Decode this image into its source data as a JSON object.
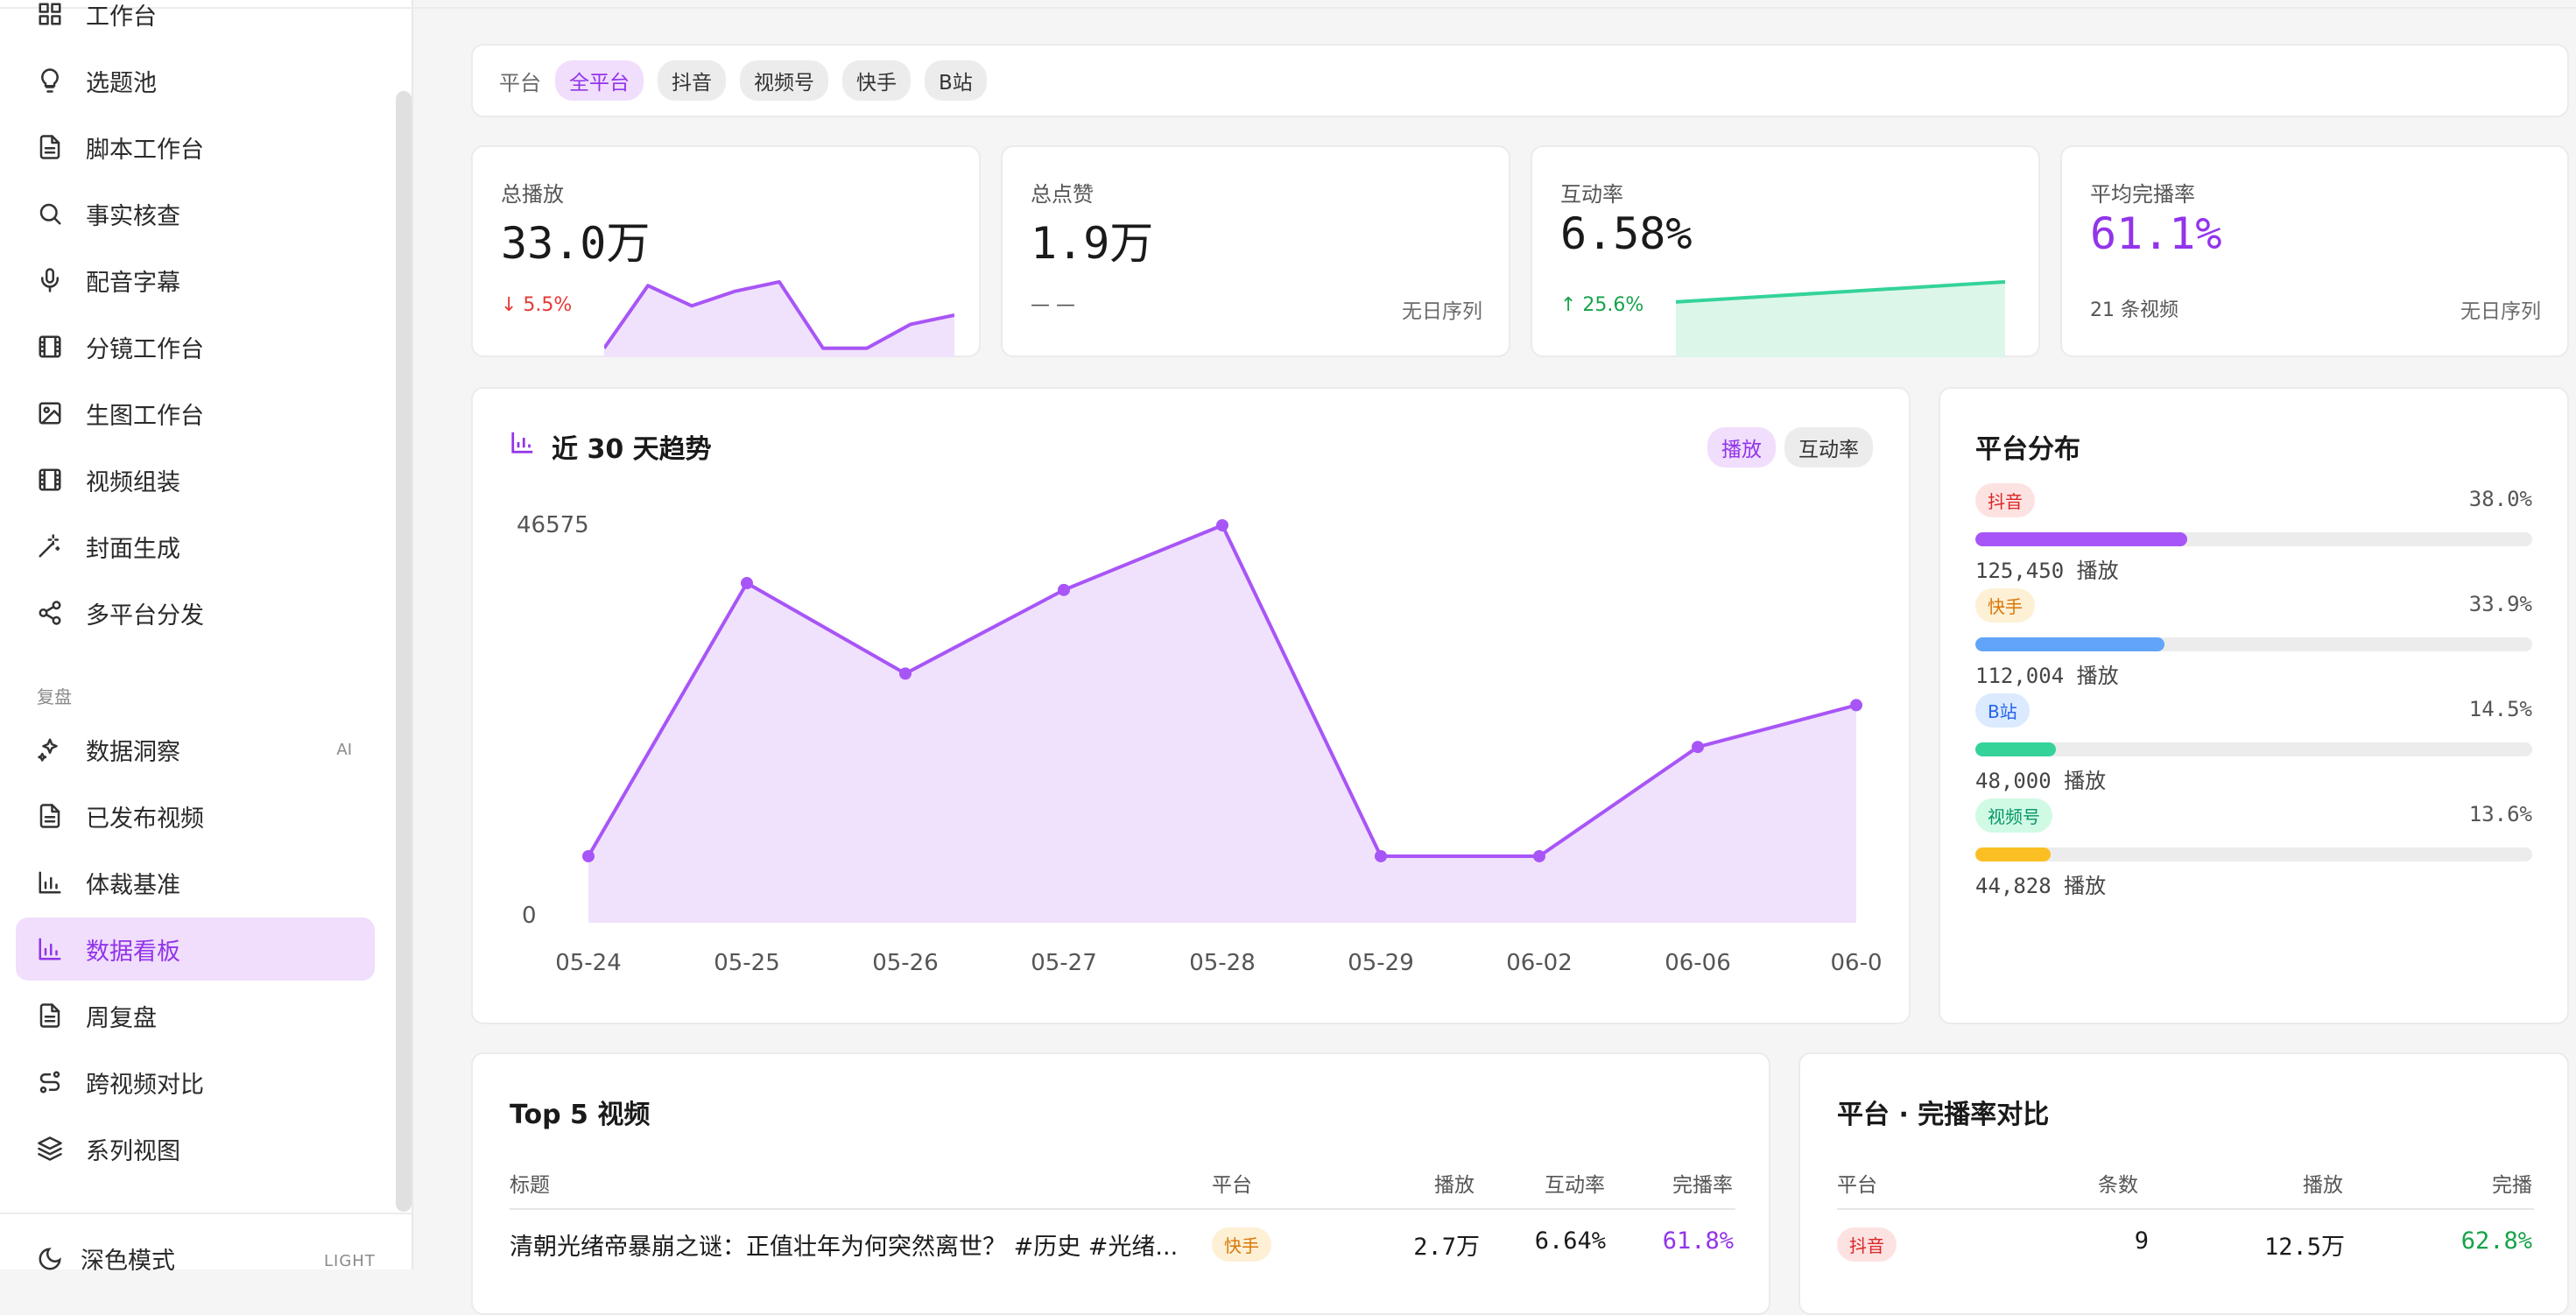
{
  "sidebar": {
    "items": [
      {
        "label": "工作台",
        "icon": "grid-icon"
      },
      {
        "label": "选题池",
        "icon": "lightbulb-icon"
      },
      {
        "label": "脚本工作台",
        "icon": "document-icon"
      },
      {
        "label": "事实核查",
        "icon": "search-icon"
      },
      {
        "label": "配音字幕",
        "icon": "microphone-icon"
      },
      {
        "label": "分镜工作台",
        "icon": "film-icon"
      },
      {
        "label": "生图工作台",
        "icon": "image-icon"
      },
      {
        "label": "视频组装",
        "icon": "film-icon"
      },
      {
        "label": "封面生成",
        "icon": "magic-wand-icon"
      },
      {
        "label": "多平台分发",
        "icon": "share-icon"
      }
    ],
    "section_review": "复盘",
    "review_items": [
      {
        "label": "数据洞察",
        "icon": "sparkles-icon",
        "badge": "AI"
      },
      {
        "label": "已发布视频",
        "icon": "document-icon"
      },
      {
        "label": "体裁基准",
        "icon": "bar-chart-icon"
      },
      {
        "label": "数据看板",
        "icon": "bar-chart-icon",
        "active": true
      },
      {
        "label": "周复盘",
        "icon": "document-icon"
      },
      {
        "label": "跨视频对比",
        "icon": "route-icon"
      },
      {
        "label": "系列视图",
        "icon": "layers-icon"
      }
    ],
    "dark_mode_label": "深色模式",
    "dark_mode_state": "LIGHT"
  },
  "filter": {
    "label": "平台",
    "chips": [
      "全平台",
      "抖音",
      "视频号",
      "快手",
      "B站"
    ],
    "active": "全平台"
  },
  "kpis": {
    "plays": {
      "label": "总播放",
      "value": "33.0万",
      "delta": "↓ 5.5%"
    },
    "likes": {
      "label": "总点赞",
      "value": "1.9万",
      "delta": "— —",
      "note": "无日序列"
    },
    "engagement": {
      "label": "互动率",
      "value": "6.58%",
      "delta": "↑ 25.6%"
    },
    "completion": {
      "label": "平均完播率",
      "value": "61.1%",
      "count": "21 条视频",
      "note": "无日序列"
    }
  },
  "trend": {
    "title": "近 30 天趋势",
    "toggle_plays": "播放",
    "toggle_engagement": "互动率"
  },
  "distribution": {
    "title": "平台分布",
    "unit": "播放",
    "platforms": [
      {
        "name": "抖音",
        "pct": "38.0%",
        "share": 0.38,
        "plays": "125,450",
        "color": "#a855f7",
        "badge_bg": "#fde2e2",
        "badge_fg": "#dc2626"
      },
      {
        "name": "快手",
        "pct": "33.9%",
        "share": 0.339,
        "plays": "112,004",
        "color": "#60a5fa",
        "badge_bg": "#fdf0d5",
        "badge_fg": "#d97706"
      },
      {
        "name": "B站",
        "pct": "14.5%",
        "share": 0.145,
        "plays": "48,000",
        "color": "#34d399",
        "badge_bg": "#dbeafe",
        "badge_fg": "#2563eb"
      },
      {
        "name": "视频号",
        "pct": "13.6%",
        "share": 0.136,
        "plays": "44,828",
        "color": "#fbbf24",
        "badge_bg": "#d1fae5",
        "badge_fg": "#059669"
      }
    ]
  },
  "top5": {
    "title": "Top 5 视频",
    "headers": {
      "title": "标题",
      "platform": "平台",
      "plays": "播放",
      "engagement": "互动率",
      "completion": "完播率"
    },
    "rows": [
      {
        "title": "清朝光绪帝暴崩之谜：正值壮年为何突然离世？ #历史 #光绪...",
        "platform": "快手",
        "plays": "2.7万",
        "engagement": "6.64%",
        "completion": "61.8%"
      }
    ]
  },
  "completion_compare": {
    "title": "平台 · 完播率对比",
    "headers": {
      "platform": "平台",
      "count": "条数",
      "plays": "播放",
      "completion": "完播"
    },
    "rows": [
      {
        "platform": "抖音",
        "count": "9",
        "plays": "12.5万",
        "completion": "62.8%"
      }
    ]
  },
  "chart_data": [
    {
      "type": "area",
      "title": "近 30 天趋势",
      "categories": [
        "05-24",
        "05-25",
        "05-26",
        "05-27",
        "05-28",
        "05-29",
        "06-02",
        "06-06",
        "06-0"
      ],
      "series": [
        {
          "name": "播放",
          "values": [
            7800,
            39800,
            29200,
            39000,
            46575,
            7800,
            7800,
            20600,
            25500
          ]
        }
      ],
      "y_tick_labels": [
        "0",
        "46575"
      ],
      "ylim": [
        0,
        46575
      ],
      "color": "#a855f7"
    },
    {
      "type": "area",
      "values": [
        2,
        36,
        25,
        33,
        38,
        2,
        2,
        15,
        20
      ]
    },
    {
      "type": "area",
      "values": [
        30,
        42
      ]
    }
  ],
  "colors": {
    "accent": "#a855f7",
    "accent_text": "#9234ea",
    "down": "#e53935",
    "up": "#16a34a"
  }
}
